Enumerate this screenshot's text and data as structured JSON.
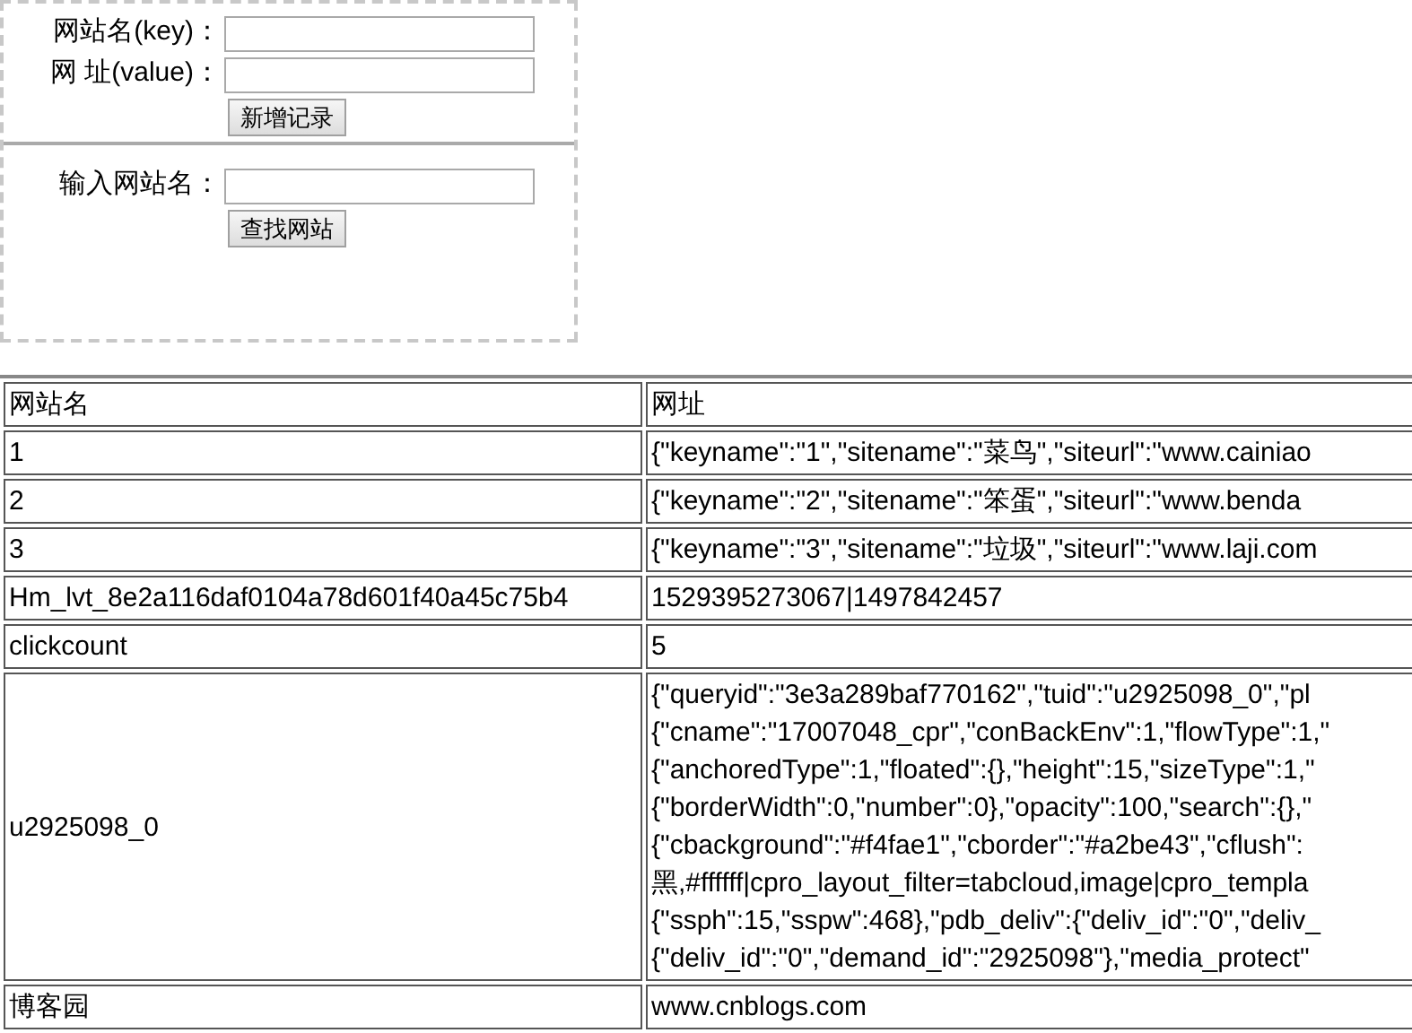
{
  "form": {
    "sections": [
      {
        "fields": [
          {
            "label": "网站名(key)："
          },
          {
            "label": "网 址(value)："
          }
        ],
        "button": "新增记录"
      },
      {
        "fields": [
          {
            "label": "输入网站名："
          }
        ],
        "button": "查找网站"
      }
    ]
  },
  "table": {
    "columns": [
      "网站名",
      "网址"
    ],
    "rows": [
      {
        "key": "1",
        "value": [
          "{\"keyname\":\"1\",\"sitename\":\"菜鸟\",\"siteurl\":\"www.cainiao"
        ]
      },
      {
        "key": "2",
        "value": [
          "{\"keyname\":\"2\",\"sitename\":\"笨蛋\",\"siteurl\":\"www.benda"
        ]
      },
      {
        "key": "3",
        "value": [
          "{\"keyname\":\"3\",\"sitename\":\"垃圾\",\"siteurl\":\"www.laji.com"
        ]
      },
      {
        "key": "Hm_lvt_8e2a116daf0104a78d601f40a45c75b4",
        "value": [
          "1529395273067|1497842457"
        ]
      },
      {
        "key": "clickcount",
        "value": [
          "5"
        ]
      },
      {
        "key": "u2925098_0",
        "value": [
          "{\"queryid\":\"3e3a289baf770162\",\"tuid\":\"u2925098_0\",\"pl",
          "{\"cname\":\"17007048_cpr\",\"conBackEnv\":1,\"flowType\":1,\"",
          "{\"anchoredType\":1,\"floated\":{},\"height\":15,\"sizeType\":1,\"",
          "{\"borderWidth\":0,\"number\":0},\"opacity\":100,\"search\":{},\"",
          "{\"cbackground\":\"#f4fae1\",\"cborder\":\"#a2be43\",\"cflush\":",
          "黑,#ffffff|cpro_layout_filter=tabcloud,image|cpro_templa",
          "{\"ssph\":15,\"sspw\":468},\"pdb_deliv\":{\"deliv_id\":\"0\",\"deliv_",
          "{\"deliv_id\":\"0\",\"demand_id\":\"2925098\"},\"media_protect\""
        ]
      },
      {
        "key": "博客园",
        "value": [
          "www.cnblogs.com"
        ]
      }
    ]
  }
}
